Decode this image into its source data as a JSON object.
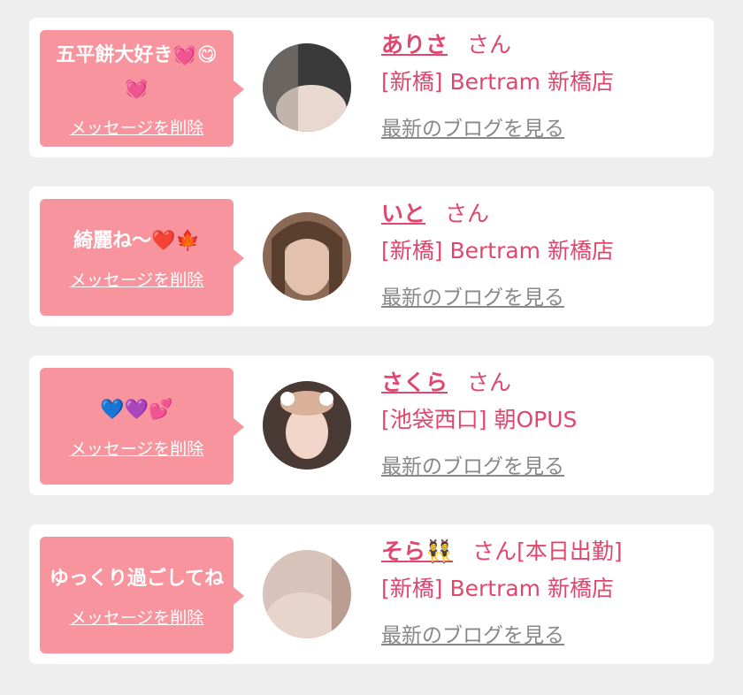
{
  "favorites": [
    {
      "message": "五平餅大好き💓😋💓",
      "delete_label": "メッセージを削除",
      "name": "ありさ",
      "suffix": "さん",
      "status": "",
      "shop": "[新橋] Bertram 新橋店",
      "blog_link": "最新のブログを見る",
      "avatar_colors": [
        "#3a3a3a",
        "#e9d8cf",
        "#9a8f88"
      ]
    },
    {
      "message": "綺麗ね〜❤️🍁",
      "delete_label": "メッセージを削除",
      "name": "いと",
      "suffix": "さん",
      "status": "",
      "shop": "[新橋] Bertram 新橋店",
      "blog_link": "最新のブログを見る",
      "avatar_colors": [
        "#8a6a55",
        "#e2c2ae",
        "#5a3e2e"
      ]
    },
    {
      "message": "💙💜💕",
      "delete_label": "メッセージを削除",
      "name": "さくら",
      "suffix": "さん",
      "status": "",
      "shop": "[池袋西口] 朝OPUS",
      "blog_link": "最新のブログを見る",
      "avatar_colors": [
        "#4a3a36",
        "#f1d5c8",
        "#d9b09a"
      ]
    },
    {
      "message": "ゆっくり過ごしてね",
      "delete_label": "メッセージを削除",
      "name": "そら👯",
      "suffix": "さん",
      "status": "[本日出勤]",
      "shop": "[新橋] Bertram 新橋店",
      "blog_link": "最新のブログを見る",
      "avatar_colors": [
        "#d8c3bb",
        "#e7d4cc",
        "#b99d92"
      ]
    }
  ]
}
